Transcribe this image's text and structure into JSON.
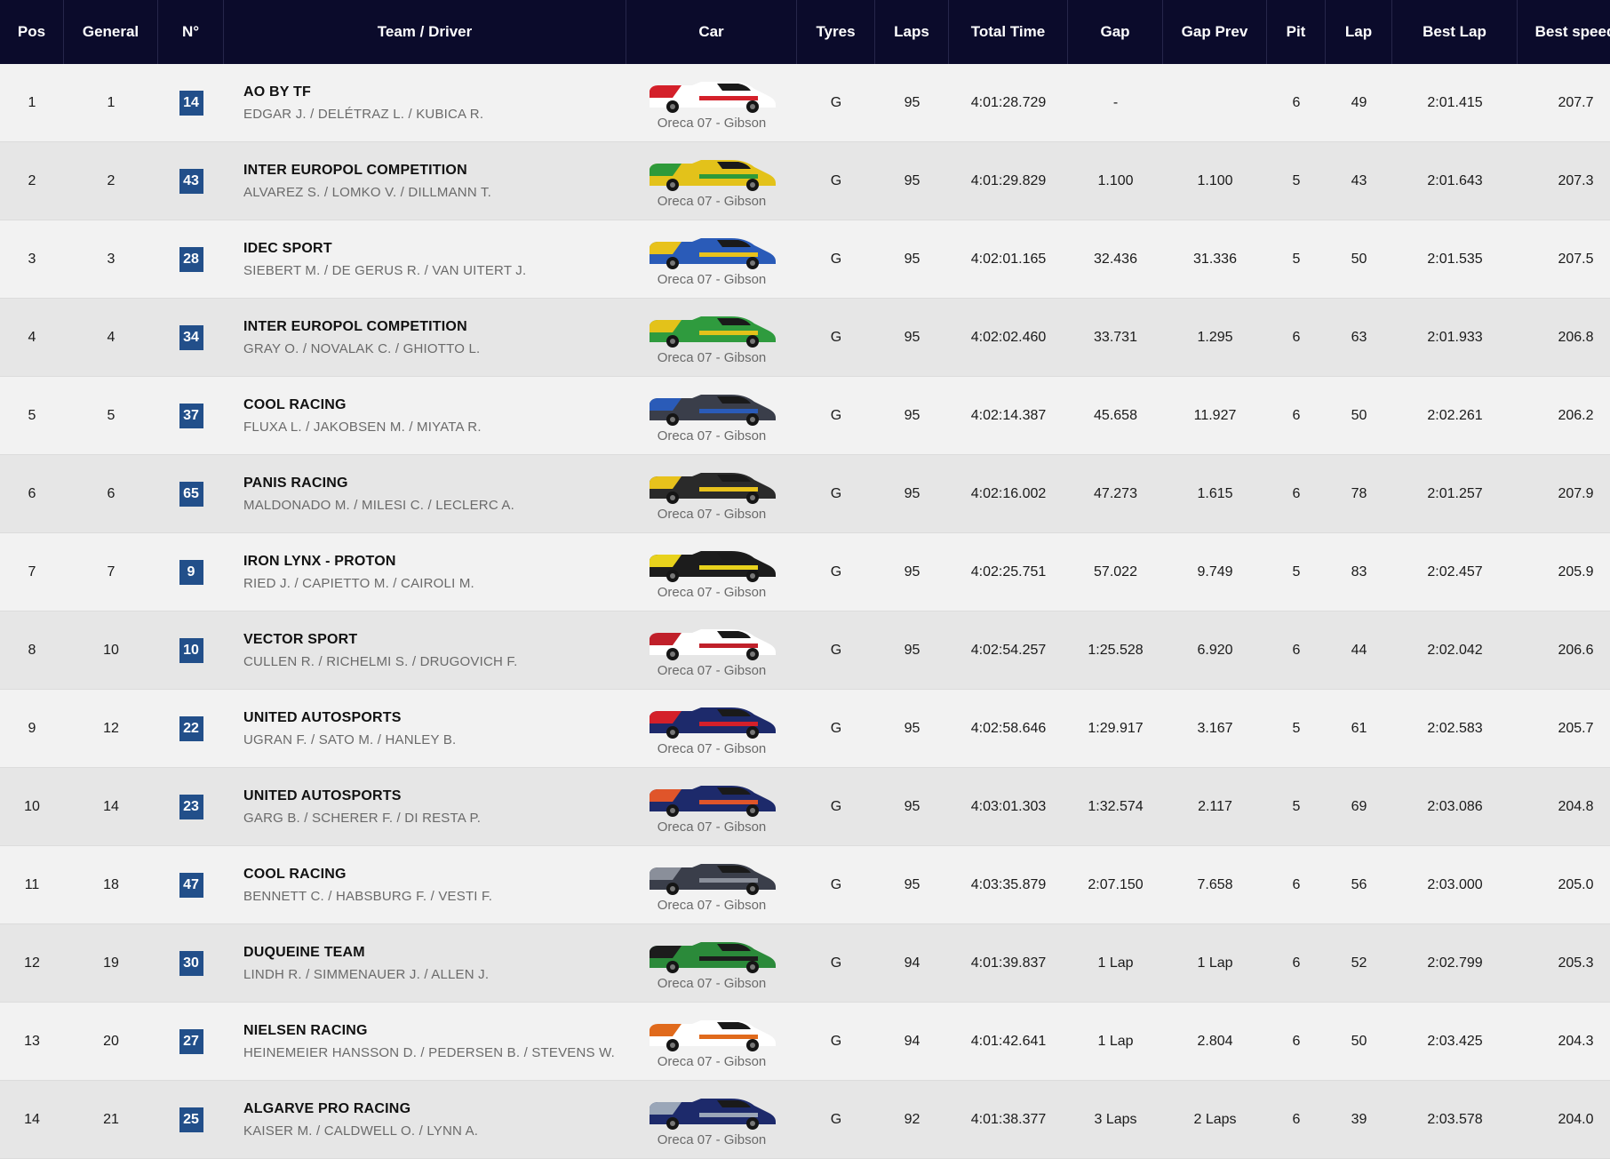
{
  "columns": [
    "Pos",
    "General",
    "N°",
    "Team / Driver",
    "Car",
    "Tyres",
    "Laps",
    "Total Time",
    "Gap",
    "Gap Prev",
    "Pit",
    "Lap",
    "Best Lap",
    "Best speed"
  ],
  "rows": [
    {
      "pos": "1",
      "general": "1",
      "num": "14",
      "team": "AO BY TF",
      "drivers": "EDGAR J. / DELÉTRAZ L. / KUBICA R.",
      "car": "Oreca 07 - Gibson",
      "tyres": "G",
      "laps": "95",
      "total_time": "4:01:28.729",
      "gap": "-",
      "gap_prev": "",
      "pit": "6",
      "lap": "49",
      "best_lap": "2:01.415",
      "best_speed": "207.7",
      "livery": {
        "primary": "#ffffff",
        "accent": "#d4202a",
        "icon": "car-livery-icon"
      }
    },
    {
      "pos": "2",
      "general": "2",
      "num": "43",
      "team": "INTER EUROPOL COMPETITION",
      "drivers": "ALVAREZ S. / LOMKO V. / DILLMANN T.",
      "car": "Oreca 07 - Gibson",
      "tyres": "G",
      "laps": "95",
      "total_time": "4:01:29.829",
      "gap": "1.100",
      "gap_prev": "1.100",
      "pit": "5",
      "lap": "43",
      "best_lap": "2:01.643",
      "best_speed": "207.3",
      "livery": {
        "primary": "#e3c21a",
        "accent": "#2e9a3a",
        "icon": "car-livery-icon"
      }
    },
    {
      "pos": "3",
      "general": "3",
      "num": "28",
      "team": "IDEC SPORT",
      "drivers": "SIEBERT M. / DE GERUS R. / VAN UITERT J.",
      "car": "Oreca 07 - Gibson",
      "tyres": "G",
      "laps": "95",
      "total_time": "4:02:01.165",
      "gap": "32.436",
      "gap_prev": "31.336",
      "pit": "5",
      "lap": "50",
      "best_lap": "2:01.535",
      "best_speed": "207.5",
      "livery": {
        "primary": "#2a5bb8",
        "accent": "#e8c21c",
        "icon": "car-livery-icon"
      }
    },
    {
      "pos": "4",
      "general": "4",
      "num": "34",
      "team": "INTER EUROPOL COMPETITION",
      "drivers": "GRAY O. / NOVALAK C. / GHIOTTO L.",
      "car": "Oreca 07 - Gibson",
      "tyres": "G",
      "laps": "95",
      "total_time": "4:02:02.460",
      "gap": "33.731",
      "gap_prev": "1.295",
      "pit": "6",
      "lap": "63",
      "best_lap": "2:01.933",
      "best_speed": "206.8",
      "livery": {
        "primary": "#2f9b3e",
        "accent": "#e3c21a",
        "icon": "car-livery-icon"
      }
    },
    {
      "pos": "5",
      "general": "5",
      "num": "37",
      "team": "COOL RACING",
      "drivers": "FLUXA L. / JAKOBSEN M. / MIYATA R.",
      "car": "Oreca 07 - Gibson",
      "tyres": "G",
      "laps": "95",
      "total_time": "4:02:14.387",
      "gap": "45.658",
      "gap_prev": "11.927",
      "pit": "6",
      "lap": "50",
      "best_lap": "2:02.261",
      "best_speed": "206.2",
      "livery": {
        "primary": "#3a3e4a",
        "accent": "#2a5bb8",
        "icon": "car-livery-icon"
      }
    },
    {
      "pos": "6",
      "general": "6",
      "num": "65",
      "team": "PANIS RACING",
      "drivers": "MALDONADO M. / MILESI C. / LECLERC A.",
      "car": "Oreca 07 - Gibson",
      "tyres": "G",
      "laps": "95",
      "total_time": "4:02:16.002",
      "gap": "47.273",
      "gap_prev": "1.615",
      "pit": "6",
      "lap": "78",
      "best_lap": "2:01.257",
      "best_speed": "207.9",
      "livery": {
        "primary": "#2a2a2a",
        "accent": "#e8c21c",
        "icon": "car-livery-icon"
      }
    },
    {
      "pos": "7",
      "general": "7",
      "num": "9",
      "team": "IRON LYNX - PROTON",
      "drivers": "RIED J. / CAPIETTO M. / CAIROLI M.",
      "car": "Oreca 07 - Gibson",
      "tyres": "G",
      "laps": "95",
      "total_time": "4:02:25.751",
      "gap": "57.022",
      "gap_prev": "9.749",
      "pit": "5",
      "lap": "83",
      "best_lap": "2:02.457",
      "best_speed": "205.9",
      "livery": {
        "primary": "#1c1c1c",
        "accent": "#e8d21c",
        "icon": "car-livery-icon"
      }
    },
    {
      "pos": "8",
      "general": "10",
      "num": "10",
      "team": "VECTOR SPORT",
      "drivers": "CULLEN R. / RICHELMI S. / DRUGOVICH F.",
      "car": "Oreca 07 - Gibson",
      "tyres": "G",
      "laps": "95",
      "total_time": "4:02:54.257",
      "gap": "1:25.528",
      "gap_prev": "6.920",
      "pit": "6",
      "lap": "44",
      "best_lap": "2:02.042",
      "best_speed": "206.6",
      "livery": {
        "primary": "#ffffff",
        "accent": "#c0202a",
        "icon": "car-livery-icon"
      }
    },
    {
      "pos": "9",
      "general": "12",
      "num": "22",
      "team": "UNITED AUTOSPORTS",
      "drivers": "UGRAN F. / SATO M. / HANLEY B.",
      "car": "Oreca 07 - Gibson",
      "tyres": "G",
      "laps": "95",
      "total_time": "4:02:58.646",
      "gap": "1:29.917",
      "gap_prev": "3.167",
      "pit": "5",
      "lap": "61",
      "best_lap": "2:02.583",
      "best_speed": "205.7",
      "livery": {
        "primary": "#1d2a6b",
        "accent": "#d4202a",
        "icon": "car-livery-icon"
      }
    },
    {
      "pos": "10",
      "general": "14",
      "num": "23",
      "team": "UNITED AUTOSPORTS",
      "drivers": "GARG B. / SCHERER F. / DI RESTA P.",
      "car": "Oreca 07 - Gibson",
      "tyres": "G",
      "laps": "95",
      "total_time": "4:03:01.303",
      "gap": "1:32.574",
      "gap_prev": "2.117",
      "pit": "5",
      "lap": "69",
      "best_lap": "2:03.086",
      "best_speed": "204.8",
      "livery": {
        "primary": "#1d2a6b",
        "accent": "#e0552a",
        "icon": "car-livery-icon"
      }
    },
    {
      "pos": "11",
      "general": "18",
      "num": "47",
      "team": "COOL RACING",
      "drivers": "BENNETT C. / HABSBURG F. / VESTI F.",
      "car": "Oreca 07 - Gibson",
      "tyres": "G",
      "laps": "95",
      "total_time": "4:03:35.879",
      "gap": "2:07.150",
      "gap_prev": "7.658",
      "pit": "6",
      "lap": "56",
      "best_lap": "2:03.000",
      "best_speed": "205.0",
      "livery": {
        "primary": "#3a3e4a",
        "accent": "#8a8f9a",
        "icon": "car-livery-icon"
      }
    },
    {
      "pos": "12",
      "general": "19",
      "num": "30",
      "team": "DUQUEINE TEAM",
      "drivers": "LINDH R. / SIMMENAUER J. / ALLEN J.",
      "car": "Oreca 07 - Gibson",
      "tyres": "G",
      "laps": "94",
      "total_time": "4:01:39.837",
      "gap": "1 Lap",
      "gap_prev": "1 Lap",
      "pit": "6",
      "lap": "52",
      "best_lap": "2:02.799",
      "best_speed": "205.3",
      "livery": {
        "primary": "#2b8a3a",
        "accent": "#1c1c1c",
        "icon": "car-livery-icon"
      }
    },
    {
      "pos": "13",
      "general": "20",
      "num": "27",
      "team": "NIELSEN RACING",
      "drivers": "HEINEMEIER HANSSON D. / PEDERSEN B. / STEVENS W.",
      "car": "Oreca 07 - Gibson",
      "tyres": "G",
      "laps": "94",
      "total_time": "4:01:42.641",
      "gap": "1 Lap",
      "gap_prev": "2.804",
      "pit": "6",
      "lap": "50",
      "best_lap": "2:03.425",
      "best_speed": "204.3",
      "livery": {
        "primary": "#ffffff",
        "accent": "#e06a1c",
        "icon": "car-livery-icon"
      }
    },
    {
      "pos": "14",
      "general": "21",
      "num": "25",
      "team": "ALGARVE PRO RACING",
      "drivers": "KAISER M. / CALDWELL O. / LYNN A.",
      "car": "Oreca 07 - Gibson",
      "tyres": "G",
      "laps": "92",
      "total_time": "4:01:38.377",
      "gap": "3 Laps",
      "gap_prev": "2 Laps",
      "pit": "6",
      "lap": "39",
      "best_lap": "2:03.578",
      "best_speed": "204.0",
      "livery": {
        "primary": "#1d2a6b",
        "accent": "#9aa6b8",
        "icon": "car-livery-icon"
      }
    }
  ],
  "colors": {
    "header_bg": "#0b0b2b",
    "badge_bg": "#224f8a",
    "row_odd": "#f2f2f2",
    "row_even": "#e6e6e6"
  }
}
